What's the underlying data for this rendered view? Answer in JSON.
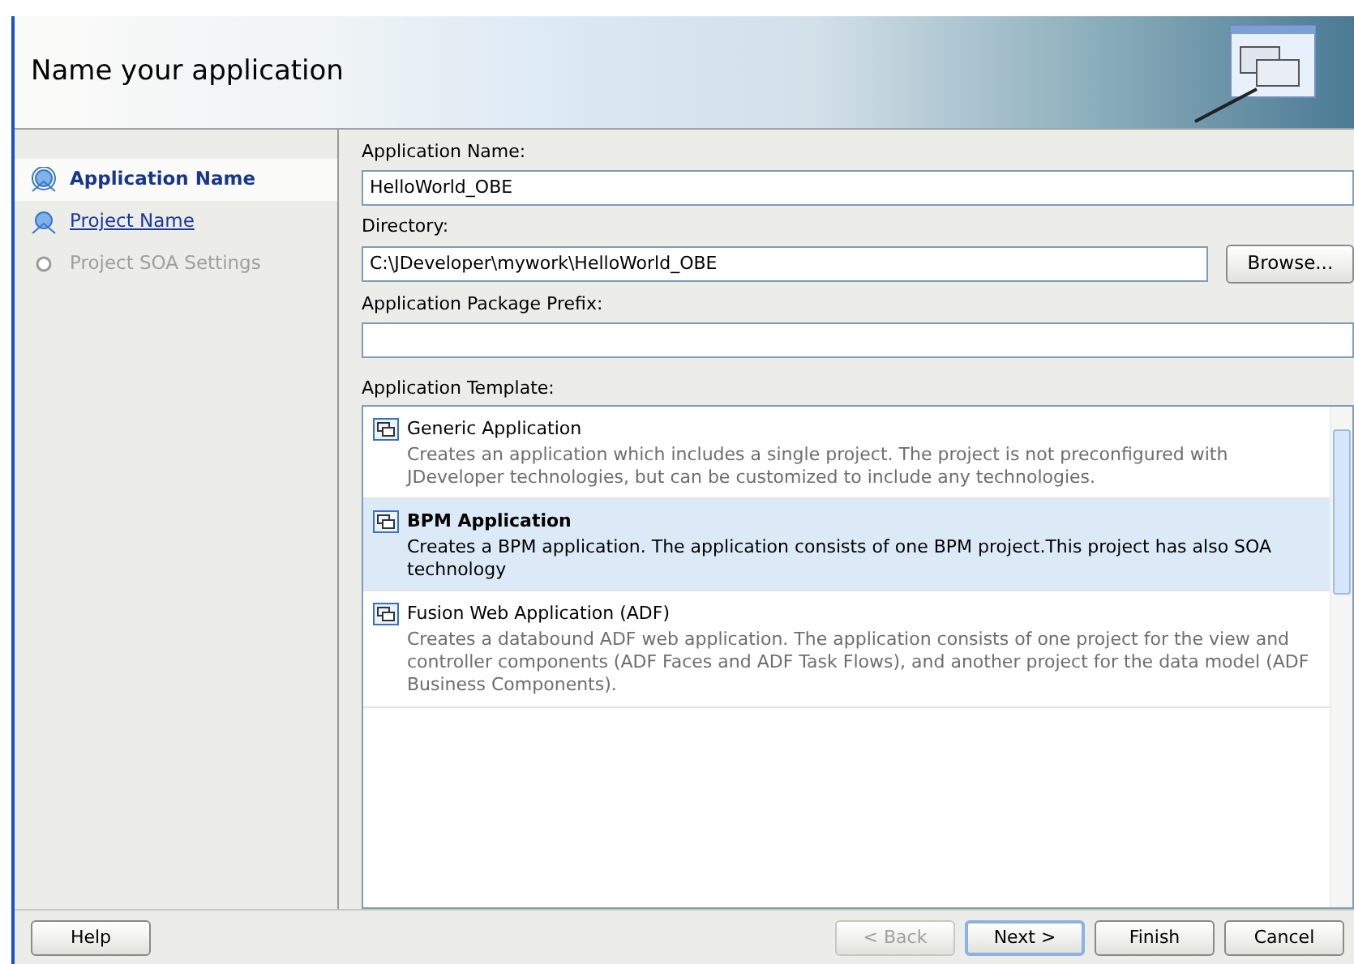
{
  "header": {
    "title": "Name your application"
  },
  "steps": [
    {
      "label": "Application Name",
      "selected": true,
      "disabled": false
    },
    {
      "label": "Project Name",
      "selected": false,
      "disabled": false
    },
    {
      "label": "Project SOA Settings",
      "selected": false,
      "disabled": true
    }
  ],
  "fields": [
    {
      "label": "Application Name:",
      "value": "HelloWorld_OBE"
    },
    {
      "label": "Directory:",
      "value": "C:\\JDeveloper\\mywork\\HelloWorld_OBE",
      "button": "Browse..."
    },
    {
      "label": "Application Package Prefix:"
    }
  ],
  "templates_label": "Application Template:",
  "templates": [
    {
      "name": "Generic Application",
      "description": "Creates an application which includes a single project. The project is not preconfigured with JDeveloper technologies, but can be customized to include any technologies.",
      "selected": false
    },
    {
      "name": "BPM Application",
      "description": "Creates a BPM application. The application consists of one BPM project.This project has also SOA technology",
      "selected": true
    },
    {
      "name": "Fusion Web Application (ADF)",
      "description": "Creates a databound ADF web application. The application consists of one project for the view and controller components (ADF Faces and ADF Task Flows), and another project for the data model (ADF Business Components).",
      "selected": false
    }
  ],
  "buttons": [
    {
      "label": "Help",
      "disabled": false,
      "default": false
    },
    {
      "label": "< Back",
      "disabled": true,
      "default": false
    },
    {
      "label": "Next >",
      "disabled": false,
      "default": true
    },
    {
      "label": "Finish",
      "disabled": false,
      "default": false
    },
    {
      "label": "Cancel",
      "disabled": false,
      "default": false
    }
  ]
}
